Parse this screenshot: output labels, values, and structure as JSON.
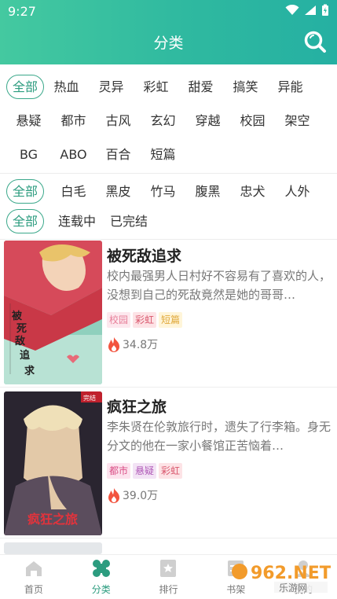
{
  "status_bar": {
    "time": "9:27"
  },
  "header": {
    "title": "分类"
  },
  "filters": {
    "category": {
      "selected": "全部",
      "options": [
        "热血",
        "灵异",
        "彩虹",
        "甜爱",
        "搞笑",
        "异能",
        "悬疑",
        "都市",
        "古风",
        "玄幻",
        "穿越",
        "校园",
        "架空",
        "BG",
        "ABO",
        "百合",
        "短篇"
      ]
    },
    "character": {
      "selected": "全部",
      "options": [
        "白毛",
        "黑皮",
        "竹马",
        "腹黑",
        "忠犬",
        "人外"
      ]
    },
    "status": {
      "selected": "全部",
      "options": [
        "连载中",
        "已完结"
      ]
    }
  },
  "books": [
    {
      "title": "被死敌追求",
      "desc": "校内最强男人日村好不容易有了喜欢的人，没想到自己的死敌竟然是她的哥哥…",
      "tags": [
        "校园",
        "彩虹",
        "短篇"
      ],
      "heat": "34.8万",
      "cover_text": "被死敌追求"
    },
    {
      "title": "疯狂之旅",
      "desc": "李朱贤在伦敦旅行时，遗失了行李箱。身无分文的他在一家小餐馆正苦恼着…",
      "tags": [
        "都市",
        "悬疑",
        "彩虹"
      ],
      "heat": "39.0万",
      "cover_text": "疯狂之旅"
    }
  ],
  "tabbar": {
    "items": [
      "首页",
      "分类",
      "排行",
      "书架",
      "我的"
    ],
    "active": "分类"
  },
  "watermark": {
    "text": "962.NET",
    "subtext": "乐游网"
  },
  "colors": {
    "accent": "#2c9c7f",
    "header_start": "#44c9a0",
    "header_end": "#25b0a2"
  }
}
